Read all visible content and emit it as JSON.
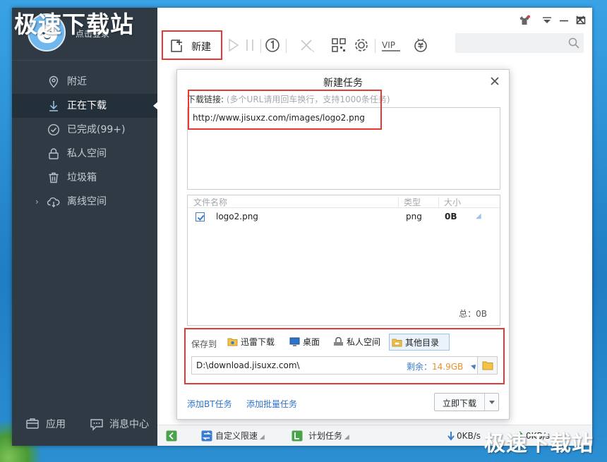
{
  "watermark": {
    "top_left": "极速下载站",
    "bottom_right": "极速下载站"
  },
  "sidebar": {
    "login": "点击登录",
    "items": [
      {
        "label": "附近",
        "icon": "location-icon"
      },
      {
        "label": "正在下载",
        "icon": "download-arrow-icon",
        "active": true
      },
      {
        "label": "已完成(99+)",
        "icon": "check-circle-icon"
      },
      {
        "label": "私人空间",
        "icon": "lock-icon"
      },
      {
        "label": "垃圾箱",
        "icon": "trash-icon"
      },
      {
        "label": "离线空间",
        "icon": "cloud-download-icon",
        "expander": "›"
      }
    ],
    "bottom": {
      "apps": "应用",
      "messages": "消息中心"
    }
  },
  "toolbar": {
    "new_label": "新建"
  },
  "statusbar": {
    "speed_limit": "自定义限速",
    "schedule": "计划任务",
    "down_speed": "0KB/s",
    "up_speed": "0KB/s"
  },
  "dialog": {
    "title": "新建任务",
    "url_label": "下载链接:",
    "url_hint": "(多个URL请用回车换行，支持1000条任务)",
    "url_value": "http://www.jisuxz.com/images/logo2.png",
    "files": {
      "headers": {
        "name": "文件名称",
        "type": "类型",
        "size": "大小"
      },
      "rows": [
        {
          "name": "logo2.png",
          "type": "png",
          "size": "0B",
          "checked": true
        }
      ],
      "total": "总：0B"
    },
    "save": {
      "label": "保存到",
      "destinations": [
        "迅雷下载",
        "桌面",
        "私人空间",
        "其他目录"
      ],
      "selected": "其他目录",
      "path": "D:\\download.jisuxz.com\\",
      "free_label": "剩余：",
      "free_value": "14.9GB"
    },
    "links": {
      "bt": "添加BT任务",
      "batch": "添加批量任务"
    },
    "download_button": "立即下载"
  },
  "colors": {
    "accent": "#2f72c9",
    "highlight": "#e53935",
    "sidebar_bg": "#2f3a45"
  }
}
